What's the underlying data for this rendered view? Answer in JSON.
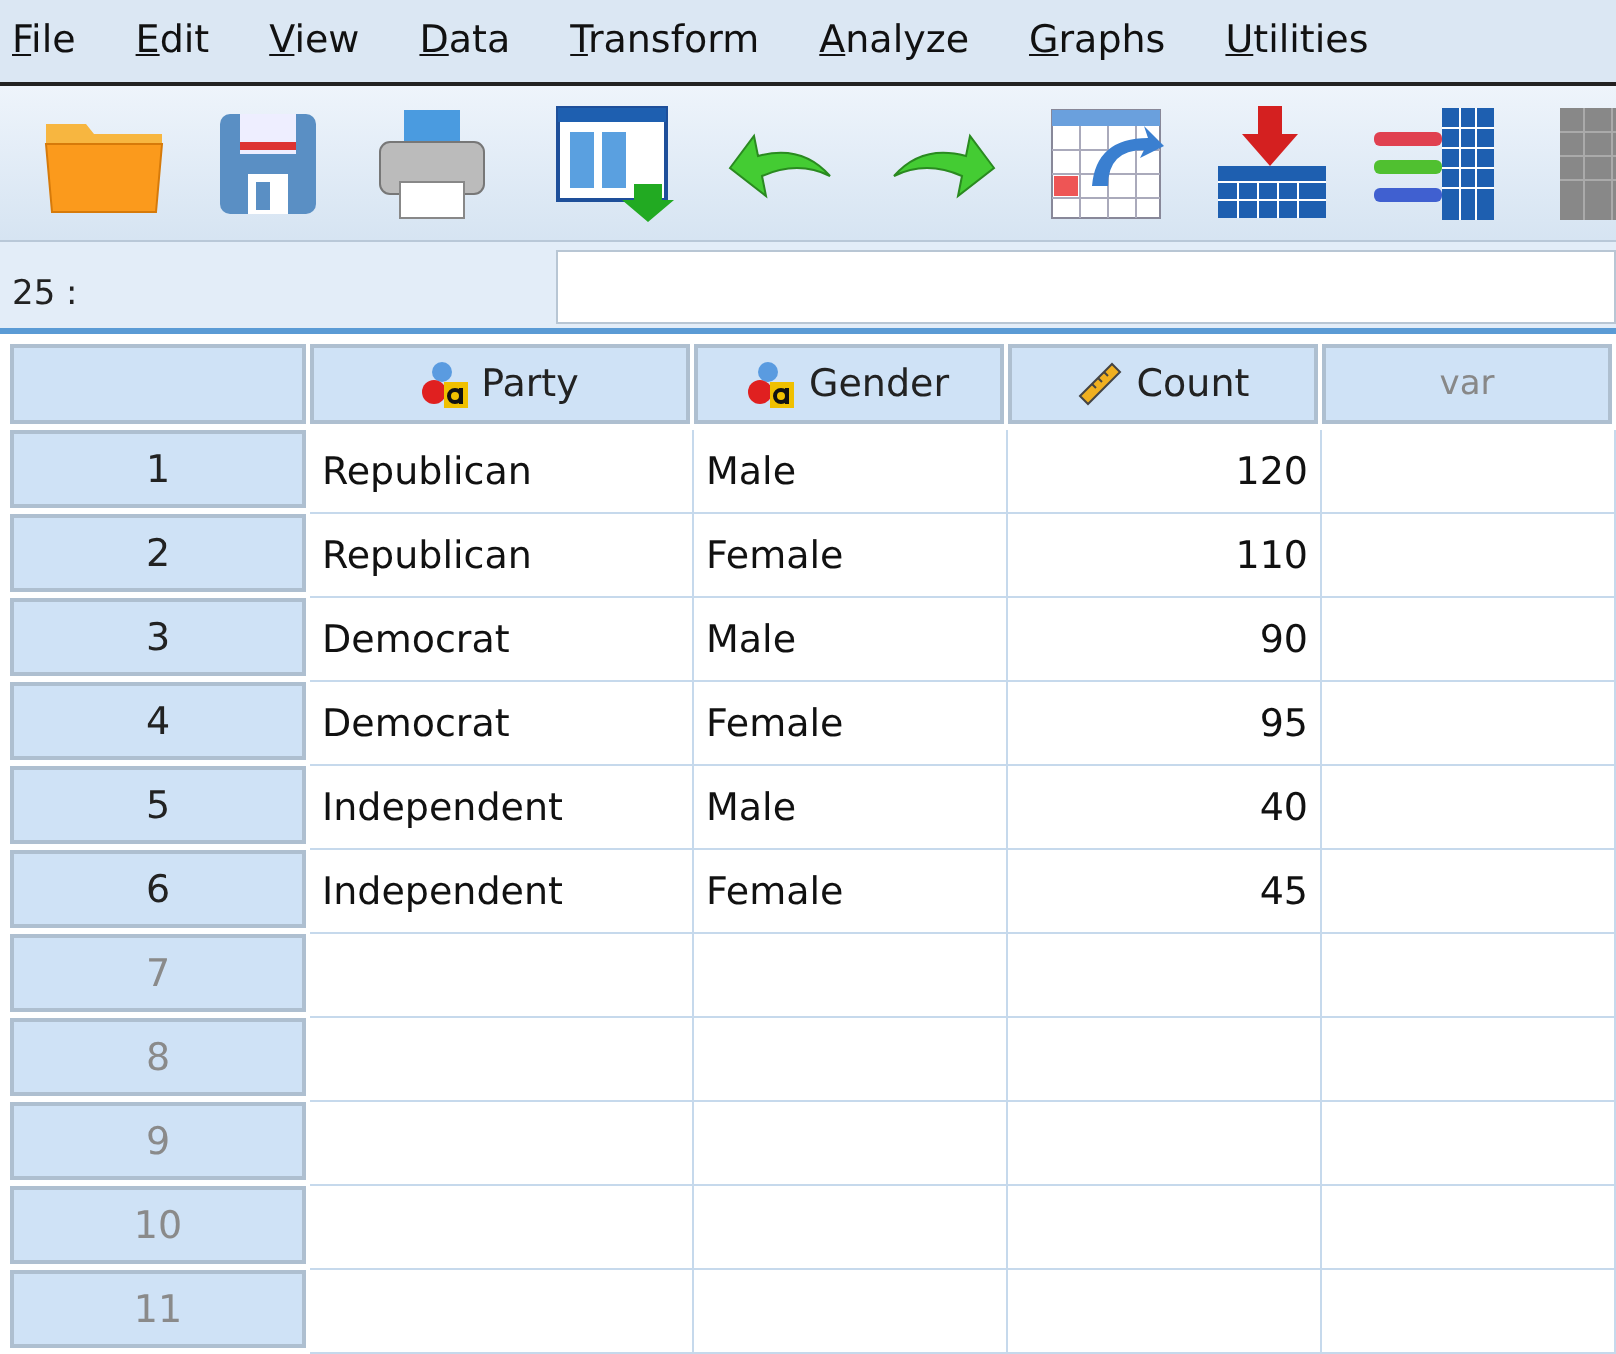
{
  "menu": [
    "File",
    "Edit",
    "View",
    "Data",
    "Transform",
    "Analyze",
    "Graphs",
    "Utilities"
  ],
  "cell_ref": {
    "label": "25 :"
  },
  "table": {
    "columns": [
      {
        "label": "Party",
        "kind": "nominal"
      },
      {
        "label": "Gender",
        "kind": "nominal"
      },
      {
        "label": "Count",
        "kind": "scale"
      },
      {
        "label": "var",
        "kind": "placeholder"
      }
    ],
    "rows": [
      {
        "number": "1",
        "empty": false,
        "cells": [
          "Republican",
          "Male",
          "120"
        ]
      },
      {
        "number": "2",
        "empty": false,
        "cells": [
          "Republican",
          "Female",
          "110"
        ]
      },
      {
        "number": "3",
        "empty": false,
        "cells": [
          "Democrat",
          "Male",
          "90"
        ]
      },
      {
        "number": "4",
        "empty": false,
        "cells": [
          "Democrat",
          "Female",
          "95"
        ]
      },
      {
        "number": "5",
        "empty": false,
        "cells": [
          "Independent",
          "Male",
          "40"
        ]
      },
      {
        "number": "6",
        "empty": false,
        "cells": [
          "Independent",
          "Female",
          "45"
        ]
      },
      {
        "number": "7",
        "empty": true
      },
      {
        "number": "8",
        "empty": true
      },
      {
        "number": "9",
        "empty": true
      },
      {
        "number": "10",
        "empty": true
      },
      {
        "number": "11",
        "empty": true
      }
    ]
  }
}
